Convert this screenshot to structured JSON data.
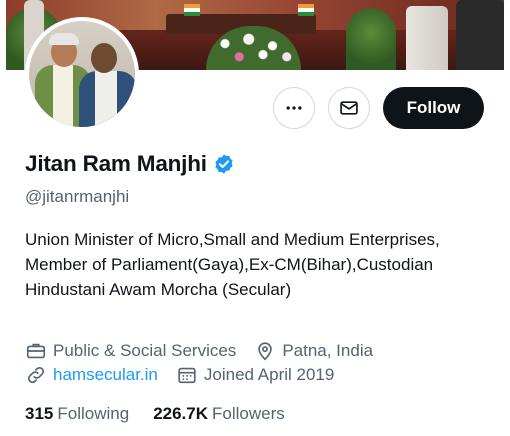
{
  "profile": {
    "name": "Jitan Ram Manjhi",
    "handle": "@jitanrmanjhi",
    "bio": "Union Minister of Micro,Small and Medium Enterprises, Member of Parliament(Gaya),Ex-CM(Bihar),Custodian Hindustani Awam Morcha (Secular)",
    "category": "Public & Social Services",
    "location": "Patna, India",
    "website": "hamsecular.in",
    "joined": "Joined April 2019",
    "following_count": "315",
    "following_label": "Following",
    "followers_count": "226.7K",
    "followers_label": "Followers"
  },
  "actions": {
    "follow_label": "Follow"
  },
  "icons": {
    "more": "more-horizontal-icon",
    "message": "envelope-icon",
    "verified": "verified-badge-icon",
    "category": "briefcase-icon",
    "location": "location-pin-icon",
    "website": "link-icon",
    "joined": "calendar-icon"
  },
  "colors": {
    "accent": "#1d9bf0",
    "text_primary": "#0f1419",
    "text_secondary": "#536471",
    "follow_button": "#0f1419",
    "border": "#cfd9de"
  }
}
